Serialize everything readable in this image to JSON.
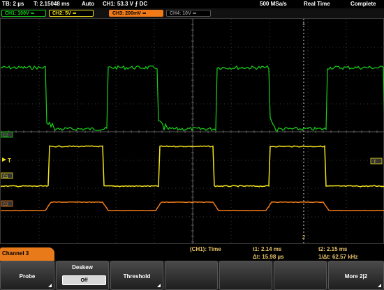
{
  "header": {
    "tb": "TB: 2 µs",
    "t": "T: 2.15048 ms",
    "mode": "Auto",
    "trigger": "CH1: 53.3 V ⨍ DC",
    "rate": "500 MSa/s",
    "acq": "Real Time",
    "status": "Complete"
  },
  "channels": [
    {
      "label": "CH1: 100V ≃",
      "color": "#19d319"
    },
    {
      "label": "CH2: 5V ≃",
      "color": "#f2e21b"
    },
    {
      "label": "CH3: 200mV ≃",
      "color": "#f07a18"
    },
    {
      "label": "CH4: 10V ≃",
      "color": "#8c8c8c"
    }
  ],
  "markers": {
    "c2": "C2",
    "t": "T",
    "c1": "C1",
    "c3": "C3",
    "right_t": "T",
    "cursor_top": "1",
    "cursor_bottom": "2"
  },
  "measure": {
    "source": "(CH1): Time",
    "t1": "t1: 2.14 ms",
    "t2": "t2: 2.15 ms",
    "dt": "Δt: 15.98 µs",
    "freq": "1/Δt: 62.57 kHz"
  },
  "menu": {
    "title": "Channel 3",
    "probe": "Probe",
    "deskew": "Deskew",
    "deskew_value": "Off",
    "threshold": "Threshold",
    "more": "More 2|2"
  }
}
